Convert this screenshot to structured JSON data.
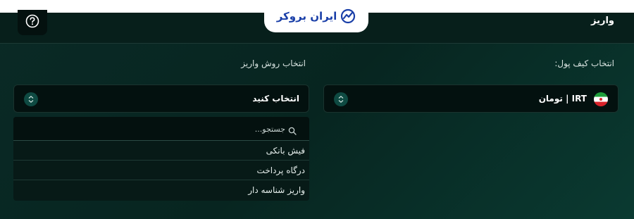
{
  "header": {
    "title": "واریز",
    "logo_text": "ایران بروکر",
    "help_icon": "question-circle-icon"
  },
  "wallet": {
    "label": "انتخاب کیف پول:",
    "selected": "IRT | تومان",
    "flag_icon": "iran-flag-icon"
  },
  "method": {
    "label": "انتخاب روش واریز",
    "selected": "انتخاب کنید",
    "search_placeholder": "جستجو...",
    "options": [
      "فیش بانکی",
      "درگاه پرداخت",
      "واریز شناسه دار"
    ]
  },
  "colors": {
    "background": "#072520",
    "header": "#071f1b",
    "accent": "#0e4a42",
    "logo": "#1a3fa8"
  }
}
